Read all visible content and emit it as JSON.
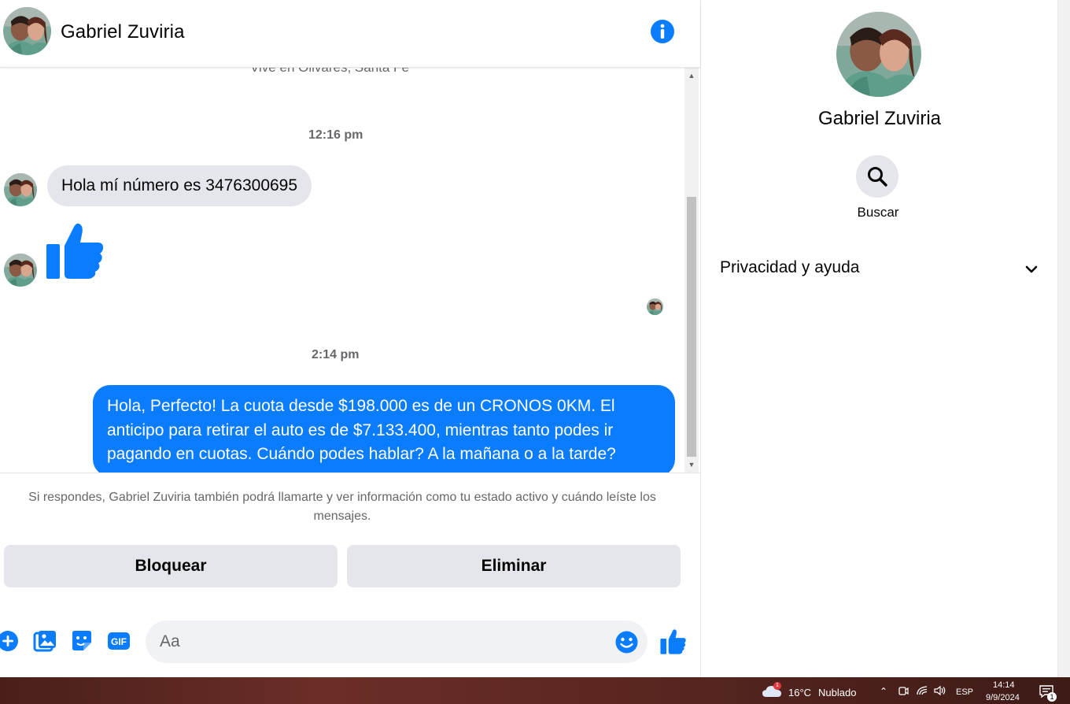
{
  "contact": {
    "name": "Gabriel Zuviria",
    "subtitle": "Vive en Olivares, Santa Fe"
  },
  "conversation": {
    "timestamp_1": "12:16 pm",
    "incoming_message": "Hola mí número es 3476300695",
    "timestamp_2": "2:14 pm",
    "outgoing_message": "Hola, Perfecto! La cuota desde $198.000 es de un CRONOS 0KM. El anticipo para retirar el auto es de $7.133.400, mientras tanto podes ir pagando en cuotas. Cuándo podes hablar? A la mañana o a la tarde?"
  },
  "notice": "Si respondes, Gabriel Zuviria también podrá llamarte y ver información como tu estado activo y cuándo leíste los mensajes.",
  "actions": {
    "block_label": "Bloquear",
    "delete_label": "Eliminar"
  },
  "composer": {
    "placeholder": "Aa",
    "gif_label": "GIF"
  },
  "side_panel": {
    "name": "Gabriel Zuviria",
    "search_label": "Buscar",
    "privacy_label": "Privacidad y ayuda"
  },
  "taskbar": {
    "temperature": "16°C",
    "condition": "Nublado",
    "weather_badge": "1",
    "language": "ESP",
    "time": "14:14",
    "date": "9/9/2024",
    "notification_count": "1"
  },
  "colors": {
    "messenger_blue": "#0a7cff",
    "bubble_gray": "#e4e6eb",
    "muted_text": "#65676b"
  },
  "icons": [
    "info-icon",
    "thumbs-up-icon",
    "plus-icon",
    "image-icon",
    "sticker-icon",
    "gif-icon",
    "emoji-icon",
    "search-icon",
    "chevron-down-icon",
    "cloud-icon",
    "wifi-icon",
    "volume-icon",
    "notification-icon"
  ]
}
